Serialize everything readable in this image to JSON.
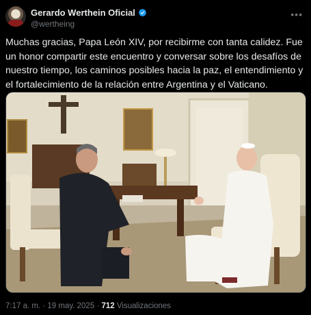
{
  "author": {
    "display_name": "Gerardo Werthein Oficial",
    "handle": "@wertheing",
    "verified_icon": "verified-badge-icon",
    "verified_color": "#1d9bf0"
  },
  "tweet": {
    "text": "Muchas gracias, Papa León XIV, por recibirme con tanta calidez. Fue un honor compartir este encuentro y conversar sobre los desafíos de nuestro tiempo, los caminos posibles hacia la paz, el entendimiento y el fortalecimiento de la relación entre Argentina y el Vaticano.",
    "image_alt_icon": "photo-meeting-image"
  },
  "meta": {
    "time": "7:17 a. m.",
    "separator1": "·",
    "date": "19 may. 2025",
    "separator2": "·",
    "views_count": "712",
    "views_label": "Visualizaciones"
  },
  "theme": {
    "background": "#000000",
    "text": "#e7e9ea",
    "secondary_text": "#71767b"
  }
}
